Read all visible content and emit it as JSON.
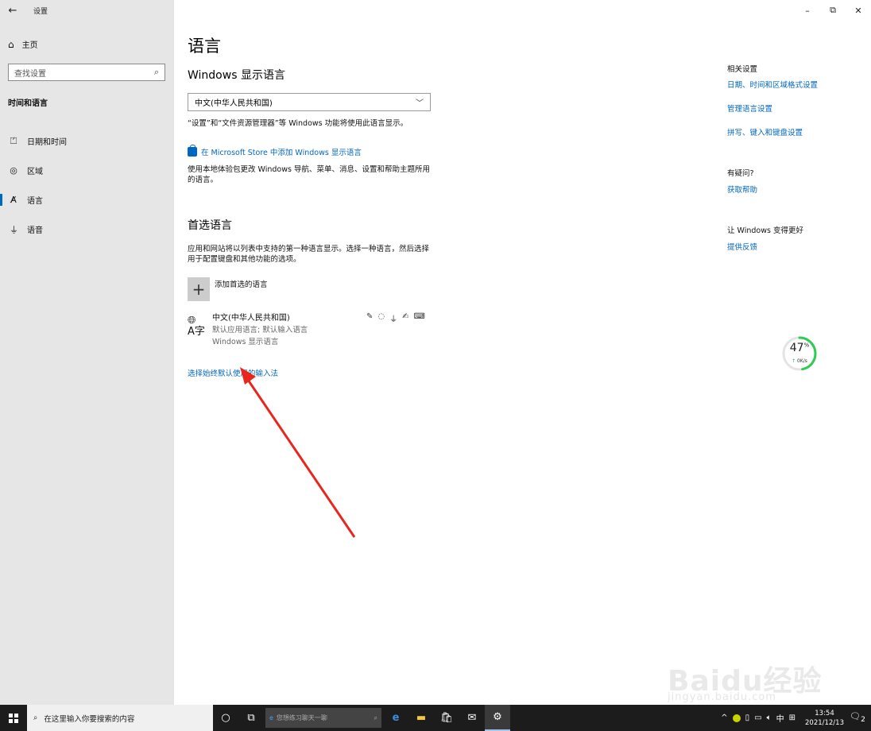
{
  "window": {
    "app_title": "设置",
    "back_icon": "←",
    "controls": {
      "minimize": "–",
      "restore": "⧉",
      "close": "✕"
    }
  },
  "sidebar": {
    "home_label": "主页",
    "search_placeholder": "查找设置",
    "section_title": "时间和语言",
    "items": [
      {
        "label": "日期和时间",
        "icon": "calendar-clock-icon",
        "glyph": "⏍"
      },
      {
        "label": "区域",
        "icon": "globe-region-icon",
        "glyph": "◎"
      },
      {
        "label": "语言",
        "icon": "language-icon",
        "glyph": "A̸"
      },
      {
        "label": "语音",
        "icon": "microphone-icon",
        "glyph": "⏚"
      }
    ],
    "active_index": 2
  },
  "main": {
    "title": "语言",
    "display_language": {
      "heading": "Windows 显示语言",
      "selected": "中文(中华人民共和国)",
      "note": "“设置”和“文件资源管理器”等 Windows 功能将使用此语言显示。",
      "store_link": "在 Microsoft Store 中添加 Windows 显示语言",
      "store_desc_line1": "使用本地体验包更改 Windows 导航、菜单、消息、设置和帮助主题所用",
      "store_desc_line2": "的语言。"
    },
    "preferred": {
      "heading": "首选语言",
      "desc_line1": "应用和网站将以列表中支持的第一种语言显示。选择一种语言，然后选择",
      "desc_line2": "用于配置键盘和其他功能的选项。",
      "add_label": "添加首选的语言",
      "languages": [
        {
          "name": "中文(中华人民共和国)",
          "sub1": "默认应用语言; 默认输入语言",
          "sub2": "Windows 显示语言"
        }
      ],
      "ime_link": "选择始终默认使用的输入法"
    }
  },
  "rail": {
    "related_heading": "相关设置",
    "related_links": [
      "日期、时间和区域格式设置",
      "管理语言设置",
      "拼写、键入和键盘设置"
    ],
    "question_heading": "有疑问?",
    "help_link": "获取帮助",
    "better_heading": "让 Windows 变得更好",
    "feedback_link": "提供反馈"
  },
  "widget": {
    "percent": 47,
    "percent_text": "47",
    "unit": "%",
    "speed": "0K/s"
  },
  "watermark": {
    "main": "Baidu经验",
    "sub": "jingyan.baidu.com"
  },
  "taskbar": {
    "search_text": "在这里输入你要搜索的内容",
    "browser_text": "您想练习聊天一聊",
    "ime": "中",
    "time": "13:54",
    "date": "2021/12/13",
    "notif_count": "2"
  },
  "colors": {
    "accent": "#0067c0",
    "sidebar_bg": "#e6e6e6",
    "arrow": "#e8271c",
    "gauge": "#2ecc50"
  }
}
